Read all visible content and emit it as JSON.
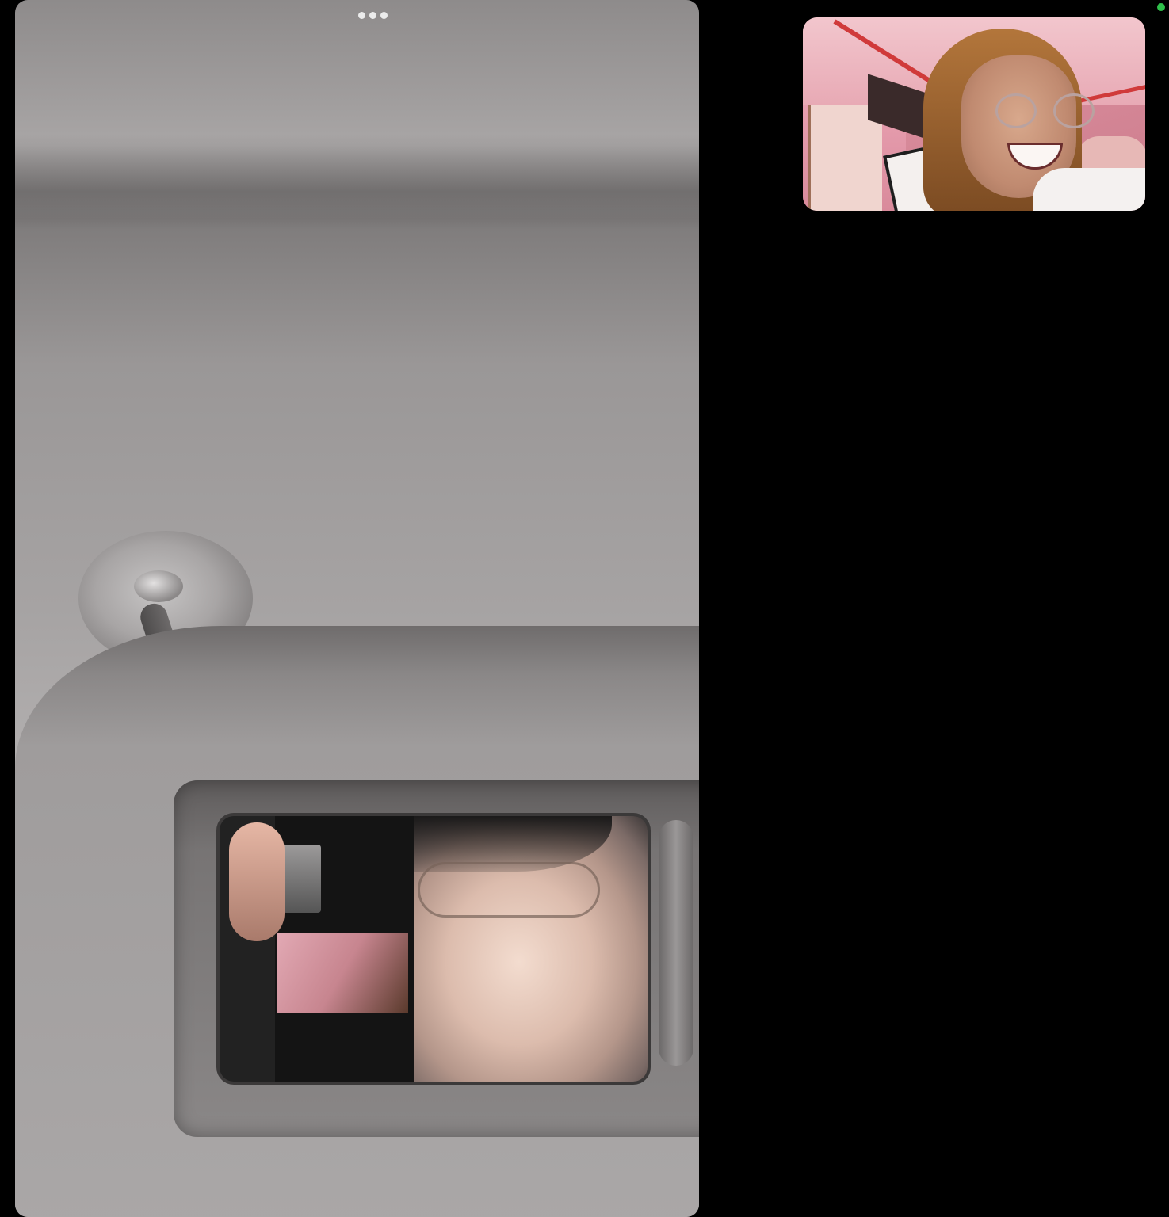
{
  "call": {
    "main_video": {
      "icon": "remote-video-feed"
    },
    "self_view": {
      "icon": "self-view-video"
    },
    "more_options": {
      "icon": "more-dots-icon"
    },
    "indicator": {
      "icon": "camera-active-dot",
      "color": "#2fbf4a"
    }
  }
}
